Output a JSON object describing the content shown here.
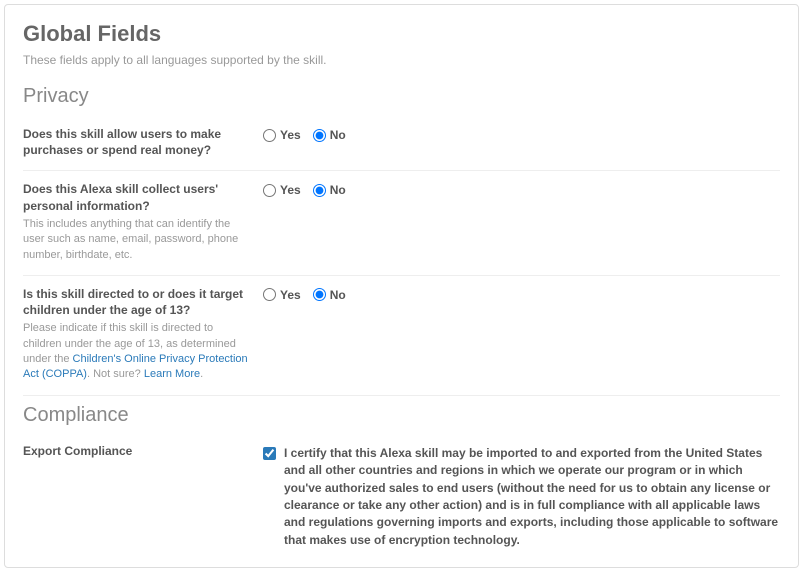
{
  "header": {
    "title": "Global Fields",
    "subtitle": "These fields apply to all languages supported by the skill."
  },
  "privacy": {
    "heading": "Privacy",
    "yes": "Yes",
    "no": "No",
    "q1": {
      "label": "Does this skill allow users to make purchases or spend real money?",
      "value": "no"
    },
    "q2": {
      "label": "Does this Alexa skill collect users' personal information?",
      "helper": "This includes anything that can identify the user such as name, email, password, phone number, birthdate, etc.",
      "value": "no"
    },
    "q3": {
      "label": "Is this skill directed to or does it target children under the age of 13?",
      "helper_prefix": "Please indicate if this skill is directed to children under the age of 13, as determined under the ",
      "helper_link": "Children's Online Privacy Protection Act (COPPA)",
      "helper_suffix": ". Not sure? ",
      "learn_more": "Learn More",
      "helper_end": ".",
      "value": "no"
    }
  },
  "compliance": {
    "heading": "Compliance",
    "label": "Export Compliance",
    "checkbox_text": "I certify that this Alexa skill may be imported to and exported from the United States and all other countries and regions in which we operate our program or in which you've authorized sales to end users (without the need for us to obtain any license or clearance or take any other action) and is in full compliance with all applicable laws and regulations governing imports and exports, including those applicable to software that makes use of encryption technology.",
    "checked": true
  }
}
